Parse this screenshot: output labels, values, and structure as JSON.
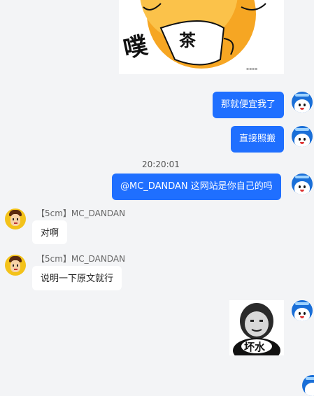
{
  "messages": [
    {
      "type": "sticker",
      "side": "right",
      "caption": "茶",
      "onomatopoeia": "噗"
    },
    {
      "type": "text",
      "side": "right",
      "text": "那就便宜我了"
    },
    {
      "type": "text",
      "side": "right",
      "text": "直接照搬"
    },
    {
      "type": "time",
      "text": "20:20:01"
    },
    {
      "type": "text",
      "side": "right",
      "text": "@MC_DANDAN 这网站是你自己的吗"
    },
    {
      "type": "text",
      "side": "left",
      "sender": "【5cm】MC_DANDAN",
      "text": "对啊"
    },
    {
      "type": "text",
      "side": "left",
      "sender": "【5cm】MC_DANDAN",
      "text": "说明一下原文就行"
    },
    {
      "type": "sticker",
      "side": "right",
      "caption": "坏水"
    }
  ],
  "colors": {
    "outgoing_bubble": "#1f6fff",
    "incoming_bubble": "#ffffff",
    "background": "#f3f4f6"
  },
  "icons": {
    "self_avatar": "blue-mascot-avatar",
    "other_avatar": "cartoon-boy-avatar"
  }
}
